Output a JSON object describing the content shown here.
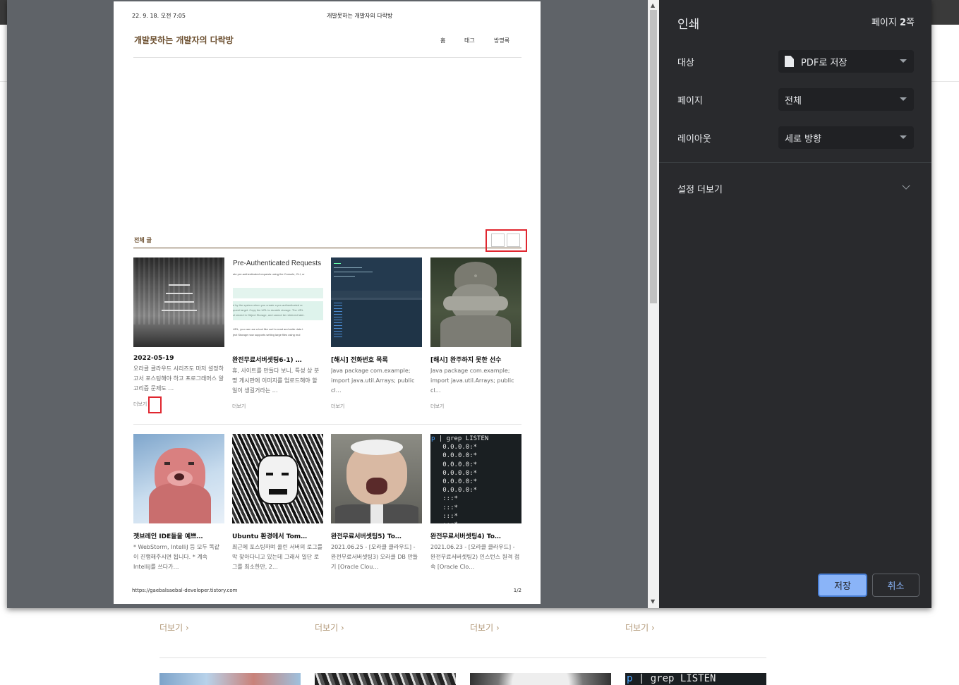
{
  "dialog": {
    "title": "인쇄",
    "page_count_prefix": "페이지 ",
    "page_count_value": "2",
    "page_count_suffix": "쪽",
    "destination_label": "대상",
    "destination_value": "PDF로 저장",
    "pages_label": "페이지",
    "pages_value": "전체",
    "layout_label": "레이아웃",
    "layout_value": "세로 방향",
    "more_settings_label": "설정 더보기",
    "save_label": "저장",
    "cancel_label": "취소"
  },
  "paper": {
    "header_date": "22. 9. 18. 오전 7:05",
    "header_title": "개발못하는 개발자의 다락방",
    "blog_title": "개발못하는 개발자의 다락방",
    "nav": [
      "홈",
      "태그",
      "방명록"
    ],
    "section_label": "전체 글",
    "more_label": "더보기",
    "footer_url": "https://gaebalsaebal-developer.tistory.com",
    "footer_page": "1/2",
    "cards": [
      {
        "title": "2022-05-19",
        "excerpt": "오라클 클라우드 시리즈도 마저 설정하고서 포스팅해야 하고 프로그래머스 알고리즘 문제도 …",
        "thumb": "sky"
      },
      {
        "title": "완전무료서버셋팅6-1) …",
        "excerpt": "휴, 사이트를 만들다 보니, 특성 상 분명 게시판에 이미지를 업로드해야 할 일이 생길거라는 …",
        "thumb": "doc"
      },
      {
        "title": "[해시] 전화번호 목록",
        "excerpt": "Java package com.example; import java.util.Arrays; public cl…",
        "thumb": "code"
      },
      {
        "title": "[해시] 완주하지 못한 선수",
        "excerpt": "Java package com.example; import java.util.Arrays; public cl…",
        "thumb": "statue"
      },
      {
        "title": "젯브레인 IDE들을 예쁘…",
        "excerpt": "* WebStorm, IntelliJ 등 모두 똑같이 진행해주시면 됩니다. * 계속 IntelliJ를 쓰다가…",
        "thumb": "beaver"
      },
      {
        "title": "Ubuntu 환경에서 Tom…",
        "excerpt": "최근에 포스팅하며 올린 서버의 로그를 막 찾아다니고 있는데 그래서 일단 로그를 최소한만, 2…",
        "thumb": "manga"
      },
      {
        "title": "완전무료서버셋팅5) To…",
        "excerpt": "2021.06.25 - [오라클 클라우드] - 완전무료서버셋팅3) 오라클 DB 만들기 [Oracle Clou…",
        "thumb": "man"
      },
      {
        "title": "완전무료서버셋팅4) To…",
        "excerpt": "2021.06.23 - [오라클 클라우드] - 완전무료서버셋팅2) 인스턴스 원격 접속 [Oracle Clo…",
        "thumb": "terminal"
      }
    ],
    "doc_thumb": {
      "heading": "Pre-Authenticated Requests",
      "line1": "ate pre-authenticated requests using the Console, CLI, or",
      "line2": "d by the system when you create a pre-authenticated re",
      "line3": "quest target. Copy the URL to durable storage. The URL",
      "line4": "ot stored in Object Storage, and cannot be retrieved later.",
      "line5": "URL, you can use a tool like curl to read and write data t",
      "line6": "ject Storage now supports writing large files using mul"
    },
    "terminal_thumb": {
      "prompt": "p",
      "command": " | grep LISTEN",
      "lines": [
        "0.0.0.0:*",
        "0.0.0.0:*",
        "0.0.0.0:*",
        "0.0.0.0:*",
        "0.0.0.0:*",
        "0.0.0.0:*",
        ":::*",
        ":::*",
        ":::*",
        ":::*"
      ]
    }
  },
  "background_page": {
    "more_label": "더보기",
    "terminal_prompt": "p",
    "terminal_command": " | grep LISTEN"
  }
}
